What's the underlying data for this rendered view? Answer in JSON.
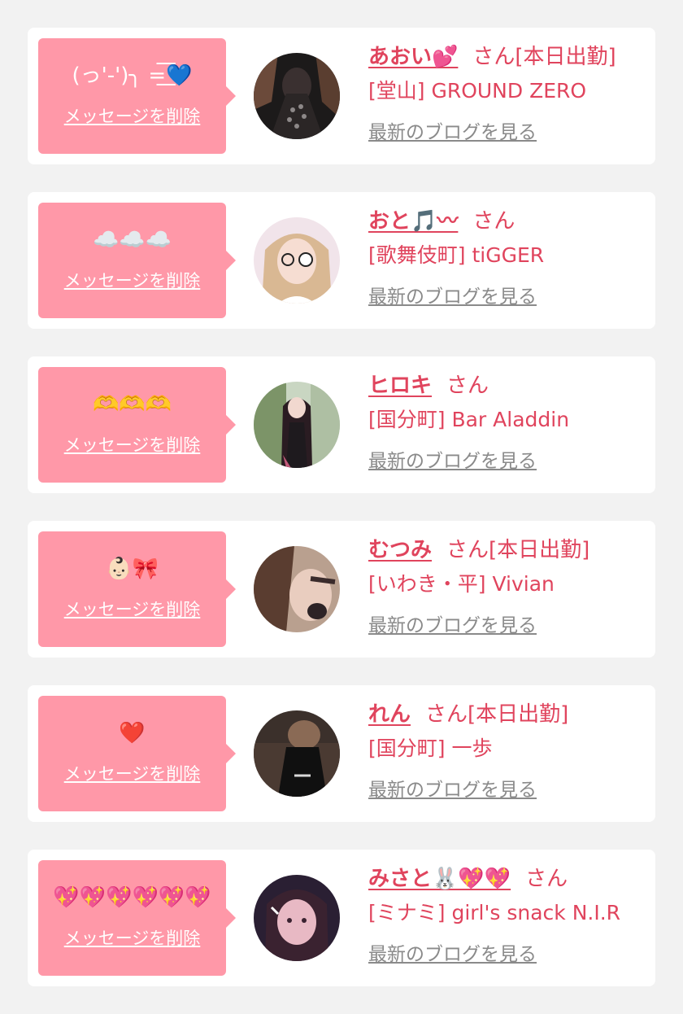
{
  "delete_label": "メッセージを削除",
  "blog_label": "最新のブログを見る",
  "honorific": "さん",
  "colors": {
    "background": "#f2f2f2",
    "bubble": "#ff98a8",
    "accent": "#e0445d",
    "link_gray": "#8a8a8a"
  },
  "cards": [
    {
      "message": "(っ'-')╮ =͟͟͞͞💙",
      "name": "あおい💕",
      "status": "[本日出勤]",
      "shop": "[堂山] GROUND ZERO",
      "avatar": "avatar-photo-aoi"
    },
    {
      "message": "☁️☁️☁️",
      "name": "おと🎵〰",
      "status": "",
      "shop": "[歌舞伎町] tiGGER",
      "avatar": "avatar-photo-oto"
    },
    {
      "message": "🫶🫶🫶",
      "name": "ヒロキ",
      "status": "",
      "shop": "[国分町] Bar Aladdin",
      "avatar": "avatar-photo-hiroki"
    },
    {
      "message": "👶🏻🎀",
      "name": "むつみ",
      "status": "[本日出勤]",
      "shop": "[いわき・平] Vivian",
      "avatar": "avatar-photo-mutsumi"
    },
    {
      "message": "❤️",
      "name": "れん",
      "status": "[本日出勤]",
      "shop": "[国分町] 一歩",
      "avatar": "avatar-photo-ren"
    },
    {
      "message": "💖💖💖💖💖💖",
      "name": "みさと🐰💖💖",
      "status": "",
      "shop": "[ミナミ] girl's snack N.I.R",
      "avatar": "avatar-photo-misato"
    }
  ]
}
